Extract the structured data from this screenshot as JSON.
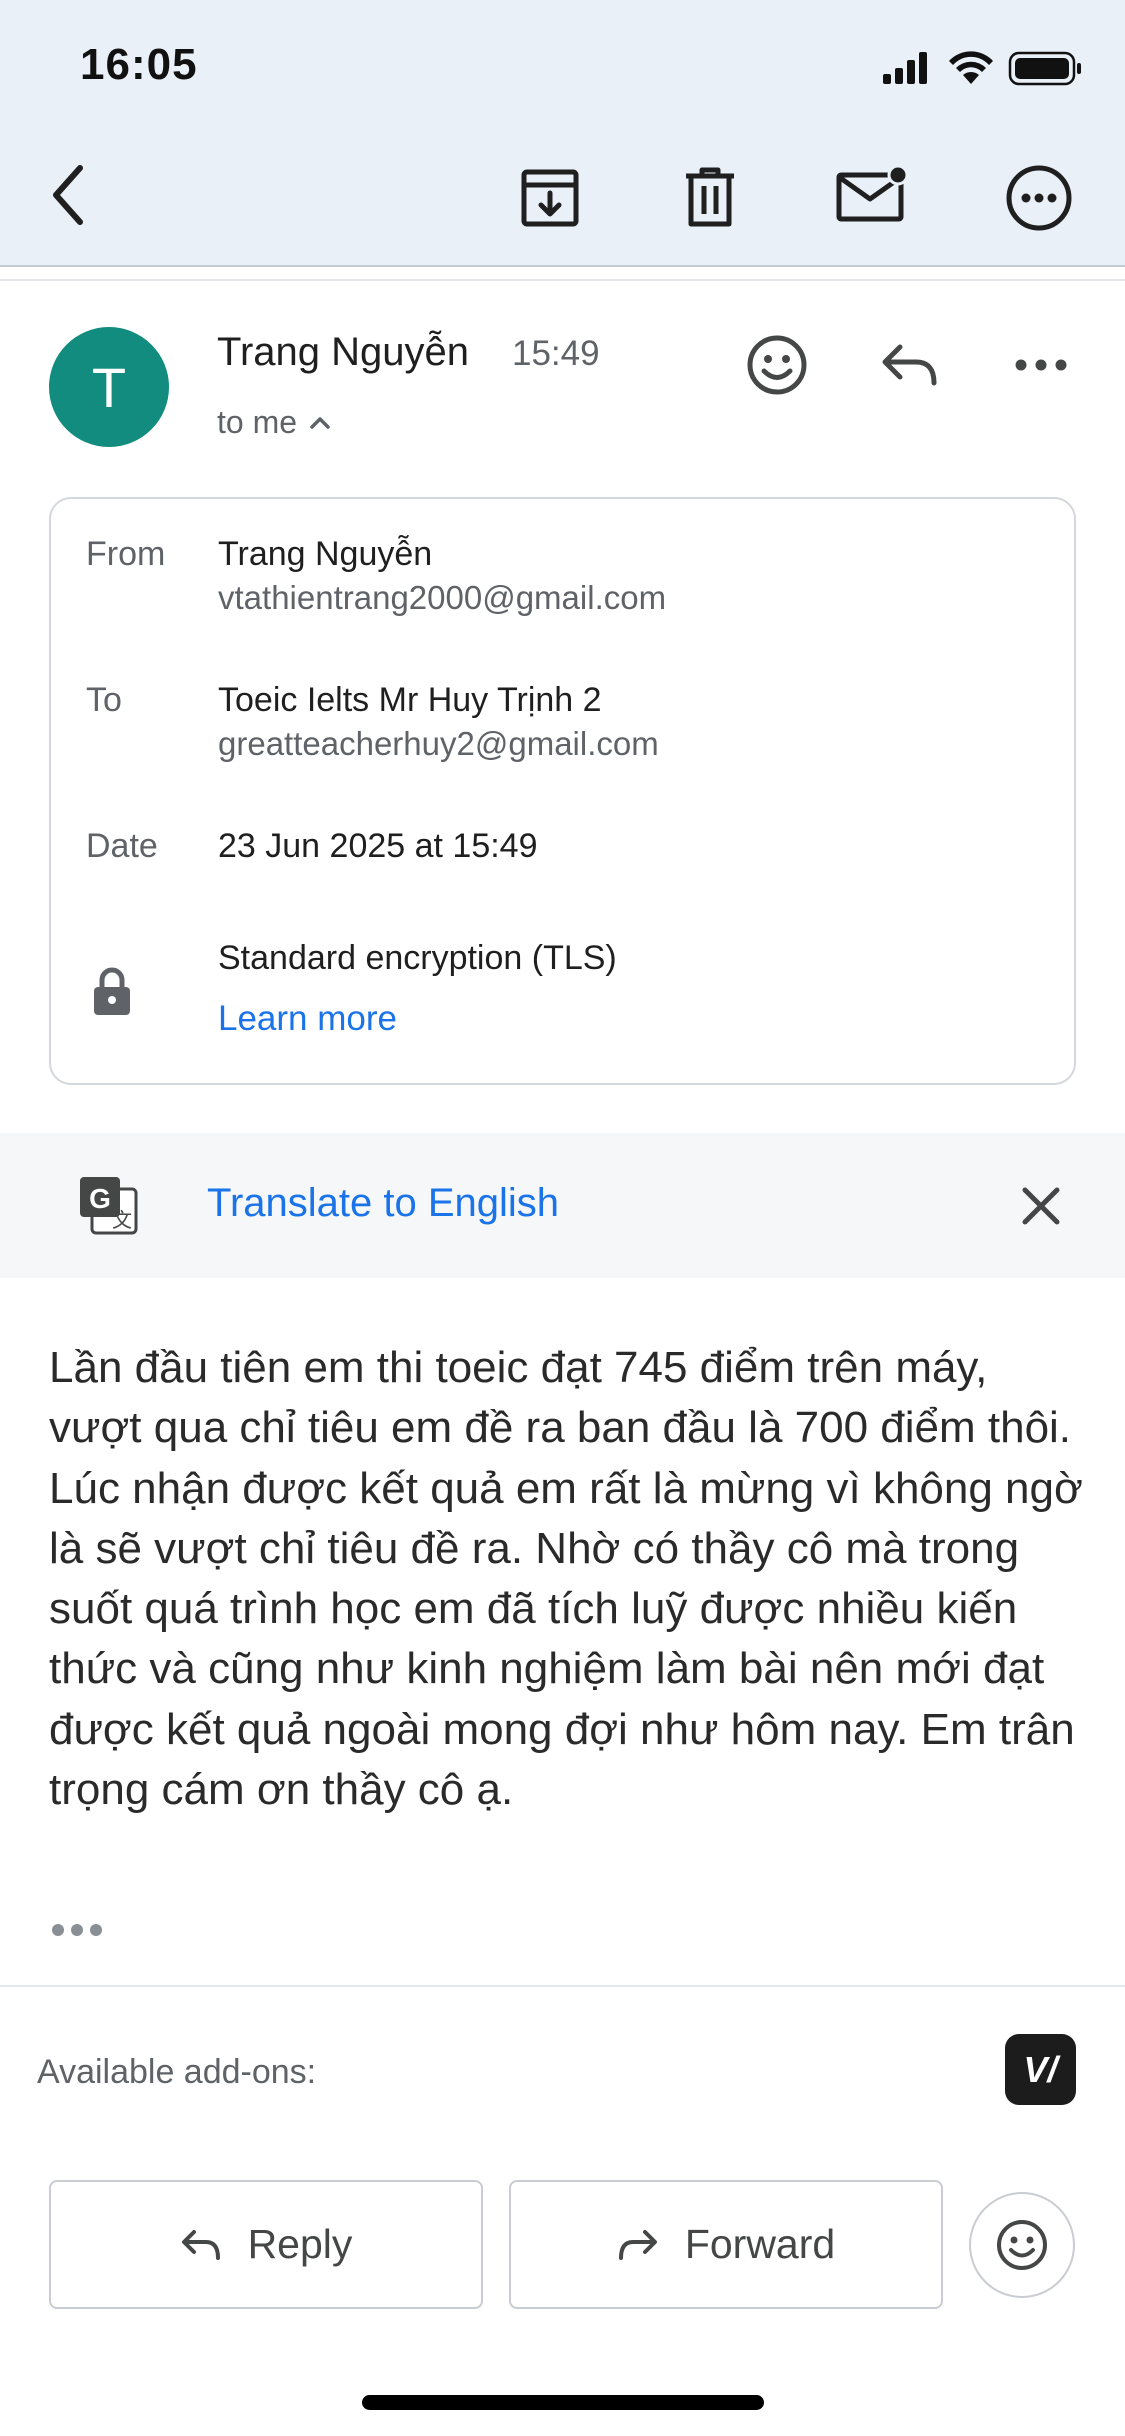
{
  "status_bar": {
    "time": "16:05"
  },
  "toolbar": {
    "back": "back-icon",
    "archive": "archive-icon",
    "delete": "trash-icon",
    "mark_unread": "mail-unread-icon",
    "more": "more-circle-icon"
  },
  "message": {
    "avatar_letter": "T",
    "avatar_color": "#128c7e",
    "sender_name": "Trang Nguyễn",
    "time": "15:49",
    "to_me": "to me",
    "details": {
      "from_label": "From",
      "from_name": "Trang Nguyễn",
      "from_email": "vtathientrang2000@gmail.com",
      "to_label": "To",
      "to_name": "Toeic Ielts Mr Huy Trịnh 2",
      "to_email": "greatteacherhuy2@gmail.com",
      "date_label": "Date",
      "date_value": "23 Jun 2025 at 15:49",
      "encryption": "Standard encryption (TLS)",
      "learn_more": "Learn more"
    },
    "translate_label": "Translate to English",
    "body": "Lần đầu tiên em thi toeic đạt 745 điểm trên máy, vượt qua chỉ tiêu em đề ra ban đầu là 700 điểm thôi. Lúc nhận được kết quả em rất là mừng vì không ngờ là sẽ vượt chỉ tiêu đề ra. Nhờ có thầy cô mà trong suốt quá trình học em đã tích luỹ được nhiều kiến thức và cũng như kinh nghiệm làm bài nên mới đạt được kết quả ngoài mong đợi như hôm nay. Em trân trọng cám ơn thầy cô ạ."
  },
  "addons": {
    "label": "Available add-ons:",
    "addon_glyph": "V/"
  },
  "actions": {
    "reply_label": "Reply",
    "forward_label": "Forward"
  },
  "colors": {
    "accent": "#1a73e8",
    "topbar_bg": "#eaf0f8"
  }
}
